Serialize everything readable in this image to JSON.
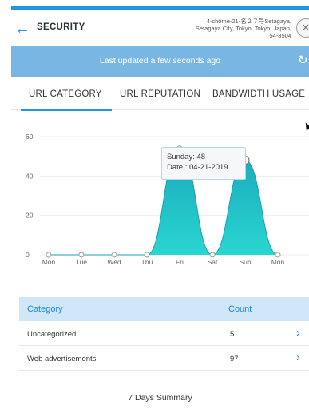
{
  "header": {
    "title": "SECURITY",
    "address": "4-chōme-21-名２７号Setagaya,\nSetagaya City, Tokyo, Tokyo, Japan,\n54-8504",
    "back_icon": "arrow-left-icon",
    "close_icon": "close-icon"
  },
  "status": {
    "updated_text": "Last updated a few seconds ago",
    "refresh_icon": "refresh-icon"
  },
  "tabs": [
    {
      "label": "URL CATEGORY",
      "active": true
    },
    {
      "label": "URL REPUTATION",
      "active": false
    },
    {
      "label": "BANDWIDTH USAGE",
      "active": false
    }
  ],
  "colors": {
    "accent": "#1e95dd",
    "bar_bg": "#79b6e3",
    "area_fill_top": "#1aa7bd",
    "area_fill_bottom": "#2ad6d0",
    "table_header_bg": "#cfe7f6"
  },
  "chart_data": {
    "type": "area",
    "categories": [
      "Mon",
      "Tue",
      "Wed",
      "Thu",
      "Fri",
      "Sat",
      "Sun",
      "Mon"
    ],
    "series": [
      {
        "values": [
          0,
          0,
          0,
          0,
          54,
          0,
          48,
          0
        ]
      }
    ],
    "y_ticks": [
      0,
      20,
      40,
      60
    ],
    "ylim": [
      0,
      60
    ],
    "grid": true,
    "tooltip": {
      "line1": "Sunday: 48",
      "line2": "Date : 04-21-2019",
      "point_index": 6
    }
  },
  "table": {
    "headers": {
      "category": "Category",
      "count": "Count"
    },
    "rows": [
      {
        "category": "Uncategorized",
        "count": "5"
      },
      {
        "category": "Web advertisements",
        "count": "97"
      }
    ]
  },
  "footer": {
    "summary": "7 Days Summary"
  }
}
